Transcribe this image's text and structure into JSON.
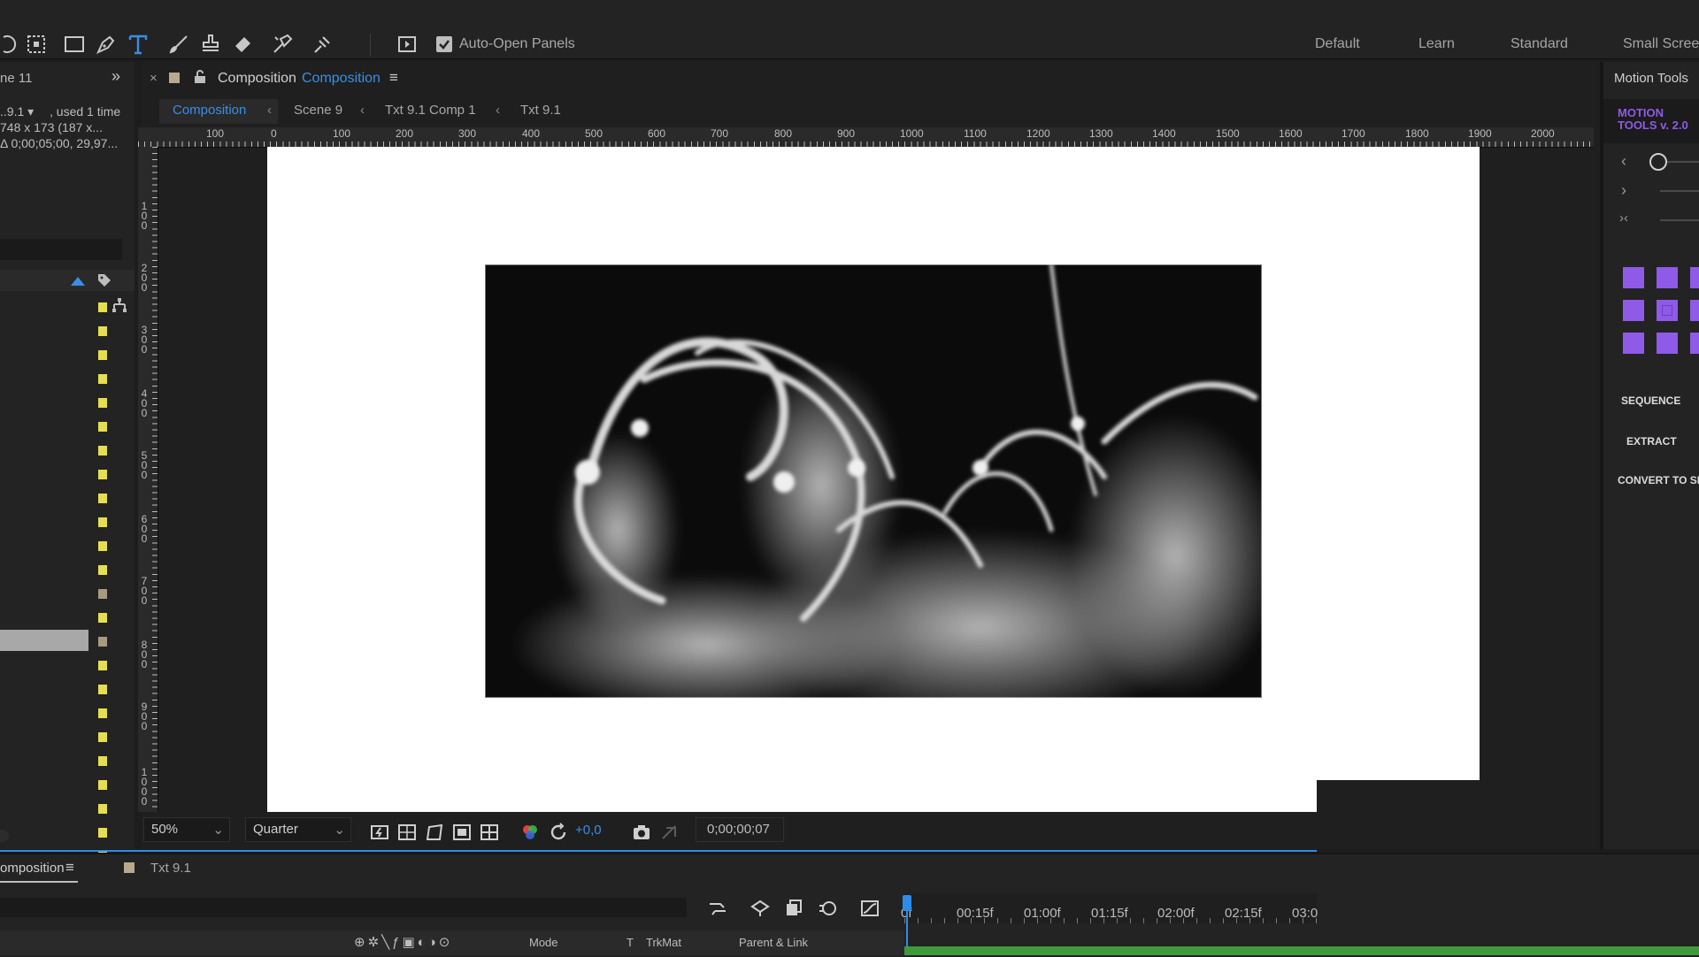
{
  "toolbar": {
    "tools": [
      "selection-ellipse-icon",
      "region-icon",
      "rectangle-icon",
      "pen-icon",
      "text-icon",
      "brush-icon",
      "clone-stamp-icon",
      "eraser-icon",
      "roto-brush-icon",
      "puppet-pin-icon"
    ],
    "auto_open_label": "Auto-Open Panels",
    "workspaces": [
      "Default",
      "Learn",
      "Standard",
      "Small Scree"
    ]
  },
  "project": {
    "tab_label": "ne 11",
    "item_name": "..9.1",
    "used": ", used 1 time",
    "dims": "748 x 173  (187 x...",
    "duration": "Δ 0;00;05;00, 29,97..."
  },
  "composition": {
    "tab_prefix": "Composition",
    "tab_name": "Composition",
    "breadcrumbs": [
      "Composition",
      "Scene 9",
      "Txt 9.1 Comp 1",
      "Txt 9.1"
    ],
    "ruler_h": [
      "100",
      "0",
      "100",
      "200",
      "300",
      "400",
      "500",
      "600",
      "700",
      "800",
      "900",
      "1000",
      "1100",
      "1200",
      "1300",
      "1400",
      "1500",
      "1600",
      "1700",
      "1800",
      "1900",
      "2000"
    ],
    "ruler_v": [
      "1\n0\n0",
      "2\n0\n0",
      "3\n0\n0",
      "4\n0\n0",
      "5\n0\n0",
      "6\n0\n0",
      "7\n0\n0",
      "8\n0\n0",
      "9\n0\n0",
      "1\n0\n0\n0"
    ],
    "zoom": "50%",
    "resolution": "Quarter",
    "exposure": "+0,0",
    "timecode": "0;00;00;07",
    "accent": "#2d8ceb",
    "canvas_color": "#ffffff"
  },
  "motion_tools": {
    "tab_label": "Motion Tools",
    "logo_line1": "MOTION",
    "logo_line2": "TOOLS v. 2.0",
    "buttons": [
      "SEQUENCE",
      "EXTRACT",
      "CONVERT TO SH"
    ],
    "accent": "#8f5ae8"
  },
  "timeline": {
    "tab_label": "omposition",
    "layer_tab": "Txt 9.1",
    "mode_label": "Mode",
    "t_label": "T",
    "trkmat_label": "TrkMat",
    "parent_label": "Parent & Link",
    "ruler": [
      "0f",
      "00:15f",
      "01:00f",
      "01:15f",
      "02:00f",
      "02:15f",
      "03:0"
    ]
  }
}
